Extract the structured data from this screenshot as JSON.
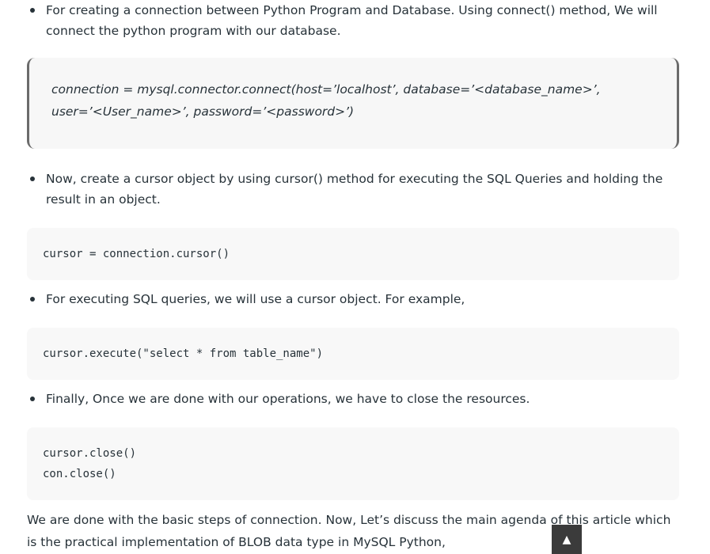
{
  "bullets": [
    {
      "text": "For creating a connection between Python Program and Database. Using connect() method, We will connect the python program with our database."
    },
    {
      "text": "Now, create a cursor object by using cursor() method for executing the SQL Queries and holding the result in an object."
    },
    {
      "text": "For executing SQL queries, we will use a cursor object. For example,"
    },
    {
      "text": "Finally, Once we are done with our operations, we have to close the resources."
    }
  ],
  "quote": {
    "line1": "connection = mysql.connector.connect(host=’localhost’, database=’<database_name>’,",
    "line2": "user=’<User_name>’, password=’<password>’)"
  },
  "code_blocks": [
    {
      "lines": [
        "cursor = connection.cursor()"
      ]
    },
    {
      "lines": [
        "cursor.execute(\"select * from table_name\")"
      ]
    },
    {
      "lines": [
        "cursor.close()",
        "con.close()"
      ]
    }
  ],
  "closing_paragraph": "We are done with the basic steps of connection. Now, Let’s discuss the main agenda of this article which is the practical implementation of BLOB data type in MySQL Python,",
  "scroll_top": {
    "icon": "▲"
  },
  "colors": {
    "text": "#273239",
    "code_bg": "#f8f8f8",
    "quote_border": "#6b6b6b",
    "scroll_button_bg": "#3b3b3b"
  }
}
